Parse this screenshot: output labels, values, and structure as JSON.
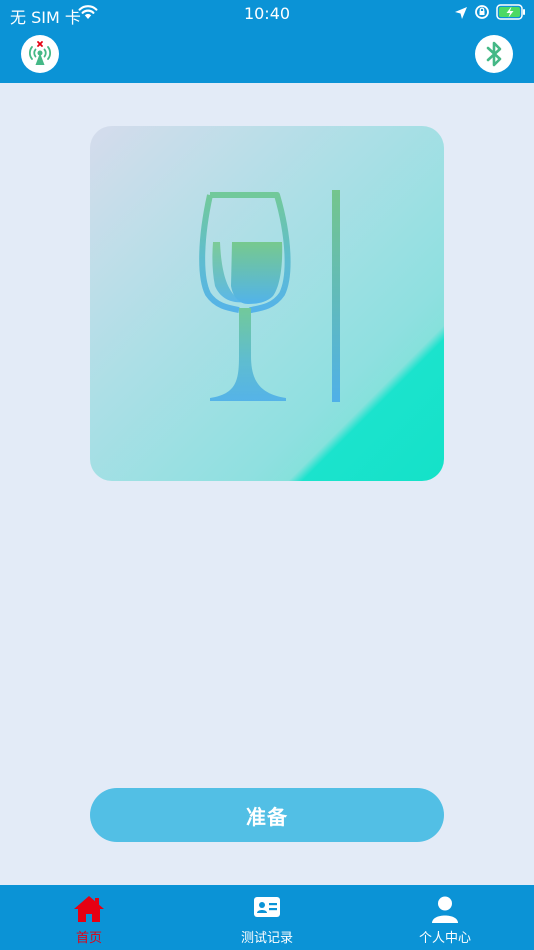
{
  "status_bar": {
    "carrier": "无 SIM 卡",
    "time": "10:40"
  },
  "colors": {
    "primary": "#0b93d6",
    "background": "#e3ebf7",
    "button": "#52bfe5",
    "active_tab": "#e60012"
  },
  "header": {
    "left_icon": "signal-tower-disconnected-icon",
    "right_icon": "bluetooth-icon"
  },
  "hero": {
    "icon": "wine-glass-with-ruler-icon"
  },
  "main": {
    "ready_button_label": "准备"
  },
  "tabbar": {
    "tabs": [
      {
        "label": "首页",
        "icon": "home-icon",
        "active": true
      },
      {
        "label": "测试记录",
        "icon": "id-card-icon",
        "active": false
      },
      {
        "label": "个人中心",
        "icon": "user-icon",
        "active": false
      }
    ]
  }
}
